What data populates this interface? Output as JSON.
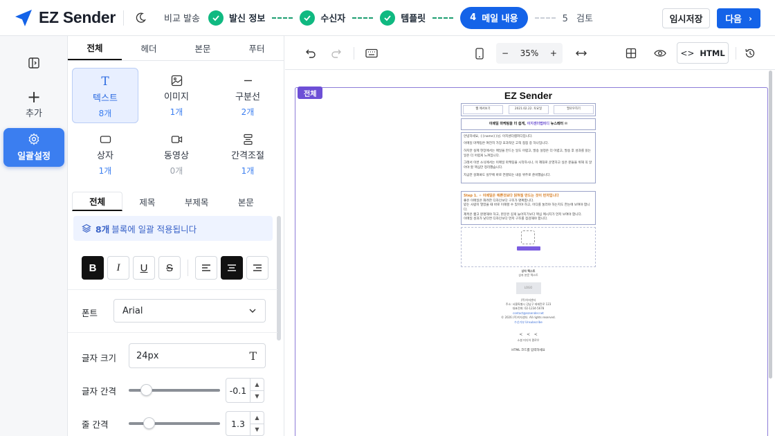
{
  "app": {
    "name": "EZ Sender",
    "brand_color": "#1463e8"
  },
  "header": {
    "breadcrumb": "비교 발송",
    "steps": [
      {
        "label": "발신 정보",
        "state": "done"
      },
      {
        "label": "수신자",
        "state": "done"
      },
      {
        "label": "템플릿",
        "state": "done"
      },
      {
        "num": "4",
        "label": "메일 내용",
        "state": "active"
      },
      {
        "num": "5",
        "label": "검토",
        "state": "pending"
      }
    ],
    "draft_label": "임시저장",
    "next_label": "다음"
  },
  "rail": {
    "items": [
      {
        "label": "",
        "icon": "sidebar-toggle-icon"
      },
      {
        "label": "추가",
        "icon": "plus-icon"
      },
      {
        "label": "일괄설정",
        "icon": "gear-icon",
        "active": true
      }
    ]
  },
  "panel": {
    "tabs": [
      "전체",
      "헤더",
      "본문",
      "푸터"
    ],
    "active_tab": "전체",
    "blocks": [
      {
        "name": "텍스트",
        "count": "8개",
        "icon": "text-icon",
        "selected": true
      },
      {
        "name": "이미지",
        "count": "1개",
        "icon": "image-icon"
      },
      {
        "name": "구분선",
        "count": "2개",
        "icon": "divider-icon"
      },
      {
        "name": "상자",
        "count": "1개",
        "icon": "box-icon"
      },
      {
        "name": "동영상",
        "count": "0개",
        "icon": "video-icon"
      },
      {
        "name": "간격조절",
        "count": "1개",
        "icon": "spacing-icon"
      }
    ],
    "subtabs": [
      "전체",
      "제목",
      "부제목",
      "본문"
    ],
    "apply_count": "8개",
    "apply_text": "블록에 일괄 적용됩니다",
    "format_buttons": {
      "bold": "B",
      "italic": "I",
      "underline": "U",
      "strike": "S"
    },
    "font_label": "폰트",
    "font_value": "Arial",
    "size_label": "글자 크기",
    "size_value": "24px",
    "letter_spacing_label": "글자 간격",
    "letter_spacing_value": "-0.1",
    "line_height_label": "줄 간격",
    "line_height_value": "1.3"
  },
  "toolbar": {
    "zoom_value": "35%",
    "zoom_minus": "−",
    "zoom_plus": "+",
    "html_label": "HTML"
  },
  "canvas": {
    "frame_label": "전체",
    "mail": {
      "title": "EZ Sender",
      "meta": [
        "웹 에서보기",
        "2021.02.22. 토요일",
        "팔로우하기"
      ],
      "headline_a": "이메일 마케팅을 더 쉽게,",
      "headline_b": "이지센더랩피디",
      "headline_c": "뉴스레터 ✉",
      "body": [
        "안녕하세요, {{name}}님. 이지센더랩피디입니다.",
        "이메일 마케팅은 여전히 가장 효과적인 고객 접점 중 하나입니다.",
        "하지만 실제 현장에서는 메일을 만드는 일도 어렵고, 발송 설정은 더 어렵고, 발송 후 성과를 읽는 일은 더 어렵게 느껴집니다.",
        "그래서 이번 소식에서는 이메일 마케팅을 시작하시나, 이 제대로 운영하고 싶은 분들을 위해 꼭 알아야 할 핵심만 정리했습니다.",
        "지금만 살펴봐도 실무에 바로 연결되는 내용 위주로 준비했습니다."
      ],
      "step_title": "Step 1. ✧ 이메일은 예쁜것보다 읽혀질 만드는 것이 먼저입니다",
      "step_body": [
        "좋은 이메일은 화려한 디자인보다 구조가 명확합니다.",
        "받는 사람이 열었을 때 바로 이해할 수 있어야 하고, 어디를 눌러야 하는지도 한눈에 보여야 합니다.",
        "제목은 짧고 분명해야 하고, 본문은 길게 늘어지기보다 핵심 메시지가 먼저 보여야 합니다.",
        "이메일 성과가 낮다면 디자인보다 먼저 구조를 점검해야 합니다."
      ],
      "box_title": "상자 텍스트",
      "box_sub": "상자 본문 텍스트",
      "logo": "LOGO",
      "footer": [
        "(주)이지센더",
        "주소: 서울특별시 강남구 테헤란로 123",
        "대표전화: 02-1234-5678",
        "contact@ezsender.net",
        "© 2026 (주)이지센더. All rights reserved.",
        "수신거부 Unsubscribe"
      ],
      "social_note": "소셜 미디어 팔로우",
      "html_note": "HTML 코드를 입력하세요"
    }
  }
}
